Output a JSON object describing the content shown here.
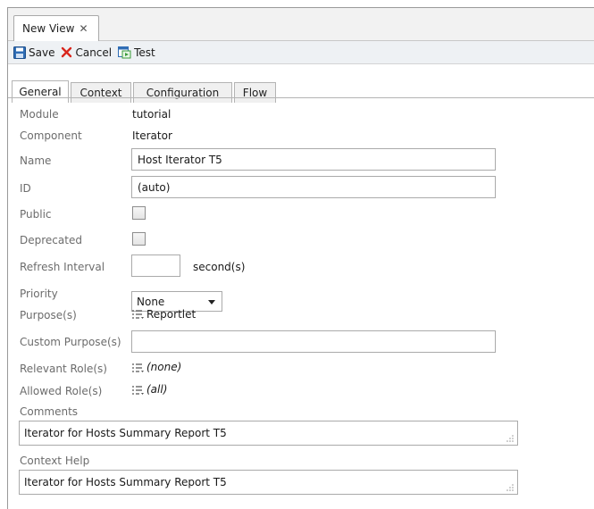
{
  "editor_tab": {
    "title": "New View",
    "close_glyph": "✕"
  },
  "toolbar": {
    "save_label": "Save",
    "cancel_label": "Cancel",
    "test_label": "Test"
  },
  "subtabs": [
    {
      "label": "General",
      "active": true
    },
    {
      "label": "Context",
      "active": false
    },
    {
      "label": "Configuration",
      "active": false
    },
    {
      "label": "Flow",
      "active": false
    }
  ],
  "form": {
    "module": {
      "label": "Module",
      "value": "tutorial"
    },
    "component": {
      "label": "Component",
      "value": "Iterator"
    },
    "name": {
      "label": "Name",
      "value": "Host Iterator T5"
    },
    "id": {
      "label": "ID",
      "value": "(auto)"
    },
    "public": {
      "label": "Public",
      "checked": false
    },
    "deprecated": {
      "label": "Deprecated",
      "checked": false
    },
    "refresh_interval": {
      "label": "Refresh Interval",
      "value": "",
      "unit": "second(s)"
    },
    "priority": {
      "label": "Priority",
      "value": "None"
    },
    "purposes": {
      "label": "Purpose(s)",
      "value": "Reportlet"
    },
    "custom_purposes": {
      "label": "Custom Purpose(s)",
      "value": ""
    },
    "relevant_roles": {
      "label": "Relevant Role(s)",
      "value": "(none)"
    },
    "allowed_roles": {
      "label": "Allowed Role(s)",
      "value": "(all)"
    },
    "comments": {
      "label": "Comments",
      "value": "Iterator for Hosts Summary Report T5"
    },
    "context_help": {
      "label": "Context Help",
      "value": "Iterator for Hosts Summary Report T5"
    }
  },
  "colors": {
    "cancel_red": "#d9261c",
    "save_blue": "#2f6db5",
    "test_green": "#3a9a3a",
    "label_gray": "#6c6c6c"
  },
  "icons": [
    "save-icon",
    "cancel-icon",
    "test-icon",
    "list-edit-icon",
    "resize-grip-icon"
  ]
}
